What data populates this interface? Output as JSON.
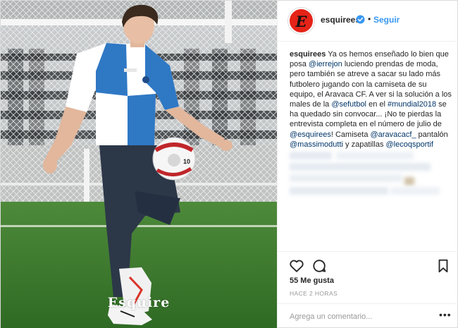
{
  "photo": {
    "alt_subject": "Post photo",
    "watermark": "Esquire",
    "ball_number": "10"
  },
  "post": {
    "username": "esquirees",
    "verified": true,
    "separator": "•",
    "follow_label": "Seguir",
    "avatar_letter": "E",
    "caption": {
      "author": "esquirees",
      "segments": [
        {
          "text": "Ya os hemos enseñado lo bien que posa ",
          "link": false
        },
        {
          "text": "@ierrejon",
          "link": true
        },
        {
          "text": " luciendo prendas de moda, pero también se atreve a sacar su lado más futbolero jugando con la camiseta de su equipo, el Aravaca CF. A ver si la solución a los males de la ",
          "link": false
        },
        {
          "text": "@sefutbol",
          "link": true
        },
        {
          "text": " en el ",
          "link": false
        },
        {
          "text": "#mundial2018",
          "link": true
        },
        {
          "text": " se ha quedado sin convocar... ¡No te pierdas la entrevista completa en el número de julio de ",
          "link": false
        },
        {
          "text": "@esquirees",
          "link": true
        },
        {
          "text": "! Camiseta ",
          "link": false
        },
        {
          "text": "@aravacacf_",
          "link": true
        },
        {
          "text": " pantalón ",
          "link": false
        },
        {
          "text": "@massimodutti",
          "link": true
        },
        {
          "text": " y zapatillas ",
          "link": false
        },
        {
          "text": "@lecoqsportif",
          "link": true
        }
      ]
    },
    "likes_label": "55 Me gusta",
    "time_label": "HACE 2 HORAS",
    "comment_placeholder": "Agrega un comentario...",
    "more_label": "•••"
  },
  "icons": {
    "like": "heart-icon",
    "comment": "comment-bubble-icon",
    "save": "bookmark-icon",
    "verified": "verified-badge-icon"
  },
  "colors": {
    "link": "#003569",
    "follow": "#3897f0",
    "avatar": "#e52318",
    "verified": "#3897f0",
    "text": "#262626",
    "muted": "#999999"
  }
}
